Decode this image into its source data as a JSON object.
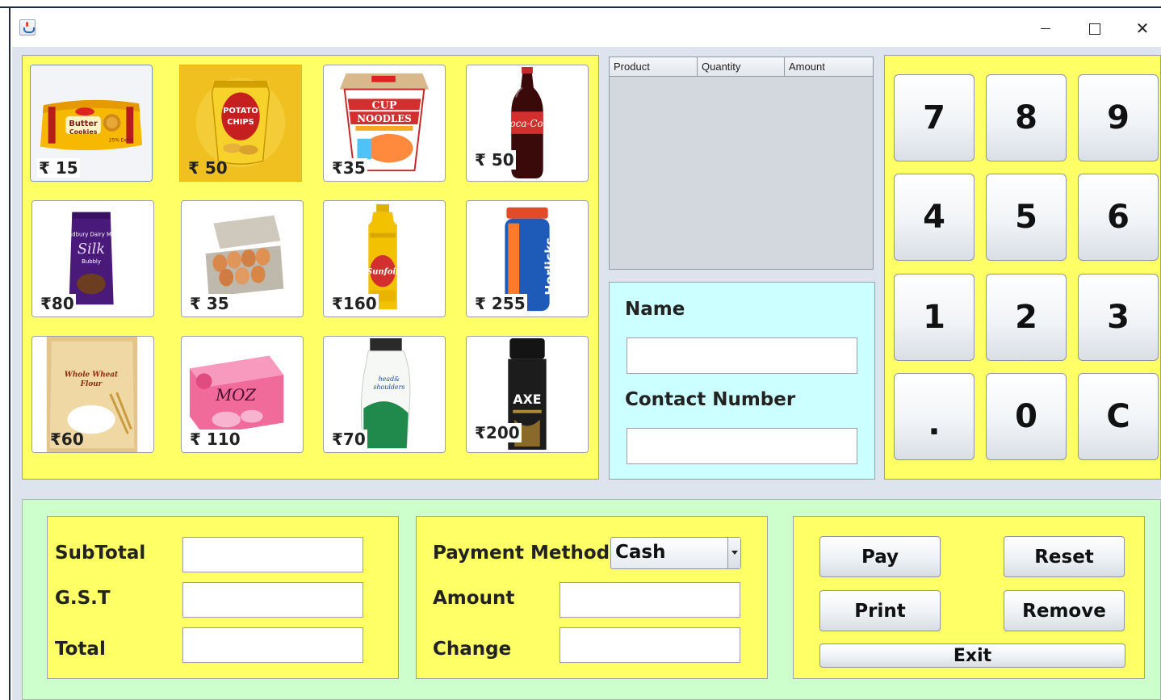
{
  "window": {
    "close_glyph": "✕"
  },
  "products": [
    {
      "id": "butter-cookies",
      "price": "₹ 15",
      "selected": true
    },
    {
      "id": "potato-chips",
      "price": "₹ 50",
      "selected": false
    },
    {
      "id": "cup-noodles",
      "price": "₹35",
      "selected": false
    },
    {
      "id": "coca-cola",
      "price": "₹ 50",
      "selected": false
    },
    {
      "id": "dairy-milk-silk",
      "price": "₹80",
      "selected": false
    },
    {
      "id": "eggs",
      "price": "₹ 35",
      "selected": false
    },
    {
      "id": "sunfoil-oil",
      "price": "₹160",
      "selected": false
    },
    {
      "id": "horlicks",
      "price": "₹ 255",
      "selected": false
    },
    {
      "id": "wheat-flour",
      "price": "₹60",
      "selected": false
    },
    {
      "id": "moz-soap",
      "price": "₹ 110",
      "selected": false
    },
    {
      "id": "head-shoulders",
      "price": "₹70",
      "selected": false
    },
    {
      "id": "axe-deodorant",
      "price": "₹200",
      "selected": false
    }
  ],
  "cart": {
    "columns": [
      "Product",
      "Quantity",
      "Amount"
    ]
  },
  "customer": {
    "name_label": "Name",
    "name_value": "",
    "contact_label": "Contact Number",
    "contact_value": ""
  },
  "keypad": [
    "7",
    "8",
    "9",
    "4",
    "5",
    "6",
    "1",
    "2",
    "3",
    ".",
    "0",
    "C"
  ],
  "totals": {
    "subtotal_label": "SubTotal",
    "subtotal_value": "",
    "gst_label": "G.S.T",
    "gst_value": "",
    "total_label": "Total",
    "total_value": ""
  },
  "payment": {
    "method_label": "Payment Method",
    "method_value": "Cash",
    "amount_label": "Amount",
    "amount_value": "",
    "change_label": "Change",
    "change_value": ""
  },
  "actions": {
    "pay": "Pay",
    "reset": "Reset",
    "print": "Print",
    "remove": "Remove",
    "exit": "Exit"
  },
  "colors": {
    "panel_yellow": "#ffff66",
    "customer_cyan": "#ccffff",
    "bottom_green": "#ccffcc",
    "background_grey": "#dde4ed"
  }
}
